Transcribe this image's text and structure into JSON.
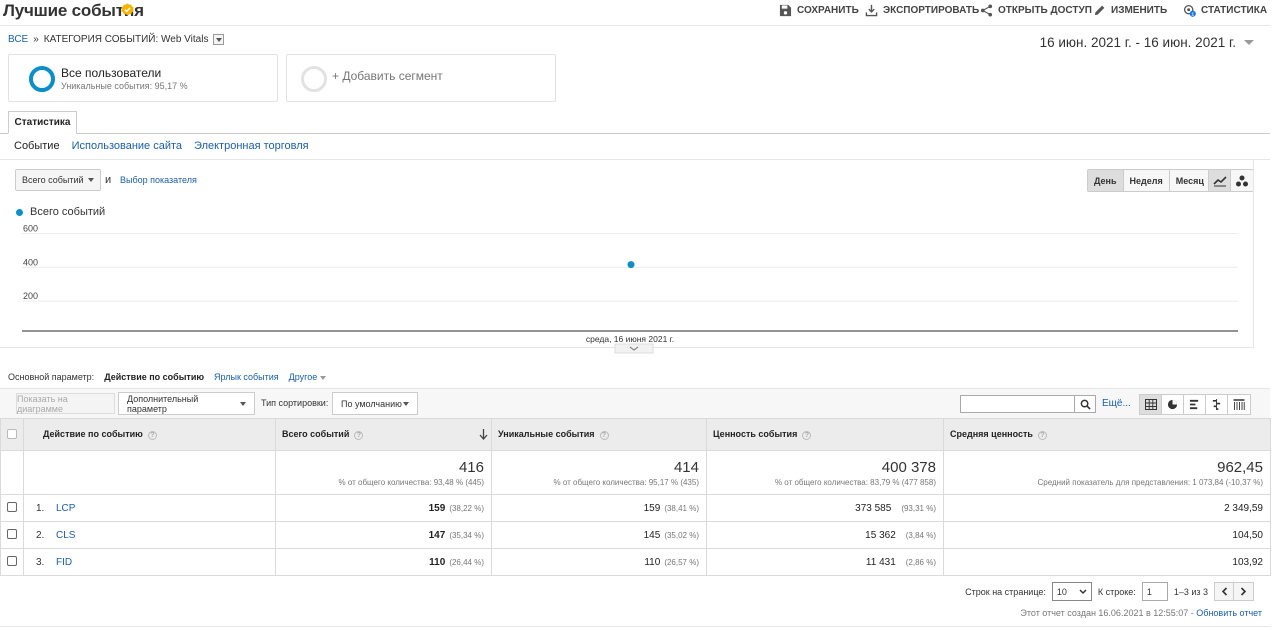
{
  "header": {
    "title": "Лучшие события",
    "actions": {
      "save": "СОХРАНИТЬ",
      "export": "ЭКСПОРТИРОВАТЬ",
      "share": "ОТКРЫТЬ ДОСТУП",
      "edit": "ИЗМЕНИТЬ",
      "stats": "СТАТИСТИКА"
    },
    "stats_badge": "1"
  },
  "breadcrumb": {
    "all": "ВСЕ",
    "sep": "»",
    "current": "КАТЕГОРИЯ СОБЫТИЙ: Web Vitals"
  },
  "date_range": "16 июн. 2021 г. - 16 июн. 2021 г.",
  "segments": {
    "all_users": "Все пользователи",
    "all_users_sub": "Уникальные события: 95,17 %",
    "add_segment": "+ Добавить сегмент"
  },
  "tabs": {
    "statistics": "Статистика"
  },
  "subnav": [
    "Событие",
    "Использование сайта",
    "Электронная торговля"
  ],
  "chart_controls": {
    "metric": "Всего событий",
    "and": "и",
    "pick_metric": "Выбор показателя",
    "periods": [
      "День",
      "Неделя",
      "Месяц"
    ]
  },
  "chart_data": {
    "type": "line",
    "series": [
      {
        "name": "Всего событий",
        "x": [
          "среда, 16 июня 2021 г."
        ],
        "values": [
          416
        ]
      }
    ],
    "yticks": [
      200,
      400,
      600
    ],
    "ylim": [
      0,
      650
    ],
    "x_label": "среда, 16 июня 2021 г.",
    "color": "#0b8fc8",
    "grid": true,
    "legend": "top-left"
  },
  "primary_dim": {
    "label": "Основной параметр:",
    "current": "Действие по событию",
    "alt1": "Ярлык события",
    "other": "Другое"
  },
  "toolbar": {
    "plot": "Показать на диаграмме",
    "secondary": "Дополнительный параметр",
    "sort_label": "Тип сортировки:",
    "sort_value": "По умолчанию",
    "more": "Ещё..."
  },
  "table": {
    "headers": {
      "action": "Действие по событию",
      "total": "Всего событий",
      "unique": "Уникальные события",
      "value": "Ценность события",
      "avg": "Средняя ценность"
    },
    "totals": {
      "total": "416",
      "total_sub": "% от общего количества: 93,48 % (445)",
      "unique": "414",
      "unique_sub": "% от общего количества: 95,17 % (435)",
      "value": "400 378",
      "value_sub": "% от общего количества: 83,79 % (477 858)",
      "avg": "962,45",
      "avg_sub": "Средний показатель для представления: 1 073,84 (-10,37 %)"
    },
    "rows": [
      {
        "idx": "1.",
        "name": "LCP",
        "total": "159",
        "total_pct": "(38,22 %)",
        "unique": "159",
        "unique_pct": "(38,41 %)",
        "value": "373 585",
        "value_pct": "(93,31 %)",
        "avg": "2 349,59"
      },
      {
        "idx": "2.",
        "name": "CLS",
        "total": "147",
        "total_pct": "(35,34 %)",
        "unique": "145",
        "unique_pct": "(35,02 %)",
        "value": "15 362",
        "value_pct": "(3,84 %)",
        "avg": "104,50"
      },
      {
        "idx": "3.",
        "name": "FID",
        "total": "110",
        "total_pct": "(26,44 %)",
        "unique": "110",
        "unique_pct": "(26,57 %)",
        "value": "11 431",
        "value_pct": "(2,86 %)",
        "avg": "103,92"
      }
    ]
  },
  "pager": {
    "rows_label": "Строк на странице:",
    "rows_value": "10",
    "goto_label": "К строке:",
    "goto_value": "1",
    "range": "1–3 из 3"
  },
  "footer": {
    "created": "Этот отчет создан 16.06.2021 в 12:55:07 -",
    "refresh": "Обновить отчет"
  }
}
